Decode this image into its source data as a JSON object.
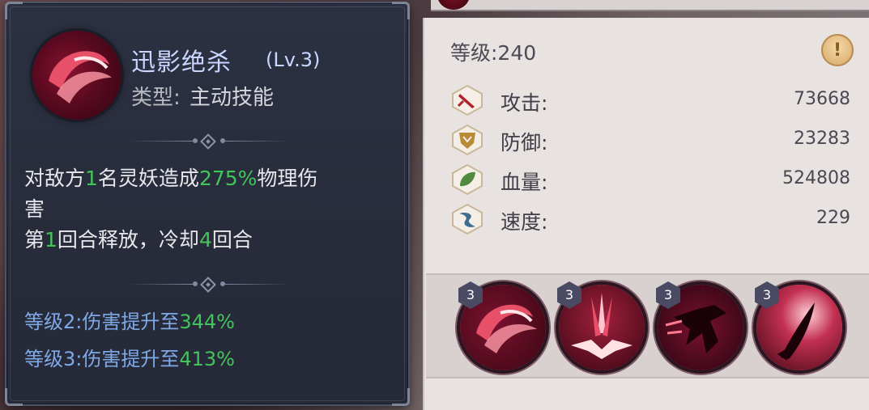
{
  "tooltip": {
    "title": "迅影绝杀",
    "level": "(Lv.3)",
    "type_label": "类型:",
    "type_value": "主动技能",
    "desc_line1_a": "对敌方",
    "desc_line1_n": "1",
    "desc_line1_b": "名灵妖造成",
    "desc_line1_pct": "275%",
    "desc_line1_c": "物理伤",
    "desc_line2": "害",
    "desc_line3_a": "第",
    "desc_line3_n1": "1",
    "desc_line3_b": "回合释放，冷却",
    "desc_line3_n2": "4",
    "desc_line3_c": "回合",
    "upgrades": [
      {
        "label": "等级2:伤害提升至",
        "value": "344%"
      },
      {
        "label": "等级3:伤害提升至",
        "value": "413%"
      }
    ]
  },
  "stats": {
    "level_text": "等级:240",
    "info_icon": "exclamation-icon",
    "rows": [
      {
        "label": "攻击:",
        "value": "73668",
        "icon": "sword-icon"
      },
      {
        "label": "防御:",
        "value": "23283",
        "icon": "shield-icon"
      },
      {
        "label": "血量:",
        "value": "524808",
        "icon": "leaf-icon"
      },
      {
        "label": "速度:",
        "value": "229",
        "icon": "wind-icon"
      }
    ]
  },
  "skills": [
    {
      "level": "3",
      "icon": "slash-swirl-icon"
    },
    {
      "level": "3",
      "icon": "burst-strike-icon"
    },
    {
      "level": "3",
      "icon": "shadow-dash-icon"
    },
    {
      "level": "3",
      "icon": "claw-blade-icon"
    }
  ],
  "colors": {
    "highlight_green": "#43c45a",
    "upgrade_blue": "#7fa9e6",
    "title_blue": "#c9d6ff"
  }
}
